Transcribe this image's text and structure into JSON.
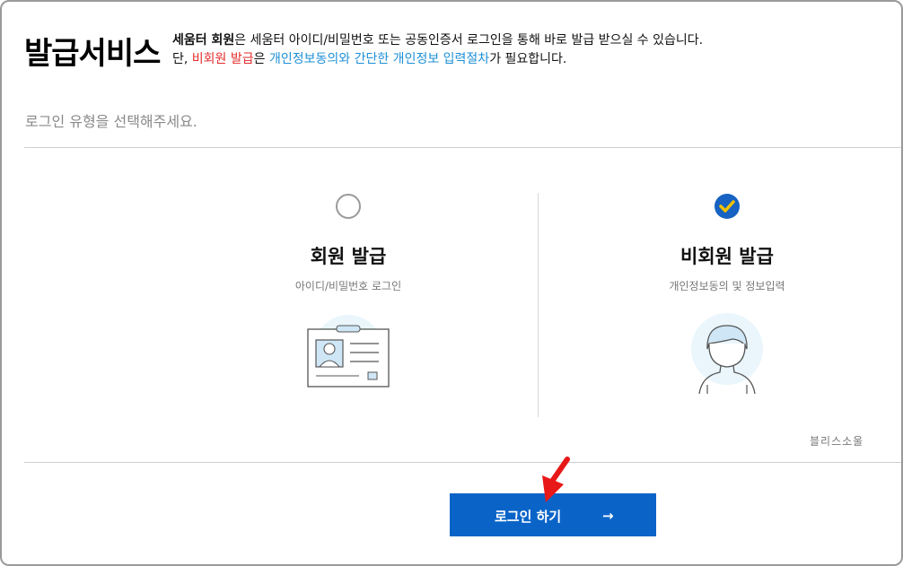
{
  "header": {
    "title": "발급서비스",
    "line1_bold": "세움터 회원",
    "line1_rest": "은 세움터 아이디/비밀번호 또는 공동인증서 로그인을 통해 바로 발급 받으실 수 있습니다.",
    "line2_prefix": "단, ",
    "line2_red": "비회원 발급",
    "line2_mid": "은 ",
    "line2_blue": "개인정보동의와 간단한 개인정보 입력절차",
    "line2_suffix": "가 필요합니다."
  },
  "subtitle": "로그인 유형을 선택해주세요.",
  "options": [
    {
      "title": "회원 발급",
      "subtitle": "아이디/비밀번호 로그인",
      "selected": false,
      "icon": "id-card-icon"
    },
    {
      "title": "비회원 발급",
      "subtitle": "개인정보동의 및 정보입력",
      "selected": true,
      "icon": "person-icon"
    }
  ],
  "watermark": "블리스소울",
  "login_button": {
    "label": "로그인 하기",
    "arrow": "→"
  },
  "colors": {
    "accent": "#0a64c8",
    "red": "#e32b2b",
    "link_blue": "#1d8fd6",
    "check_fill": "#1762c2",
    "check_mark": "#f2c200"
  }
}
